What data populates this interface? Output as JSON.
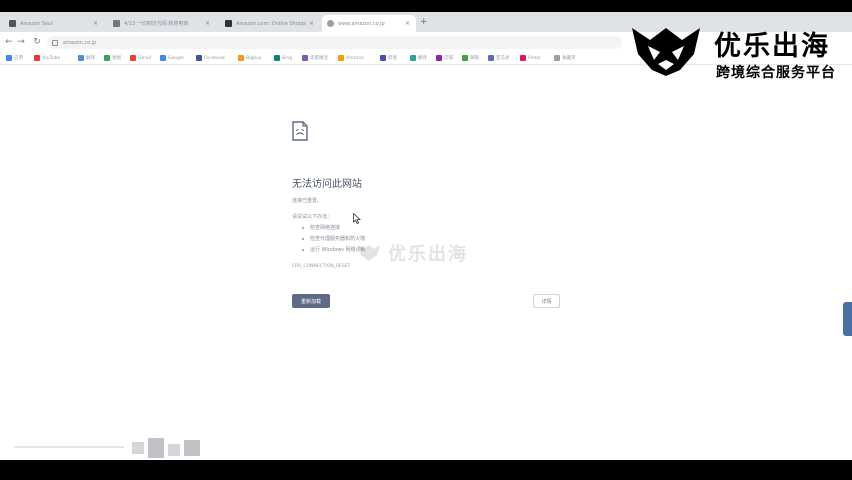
{
  "tabs": [
    {
      "label": "Amazon Seul",
      "active": false
    },
    {
      "label": "4/13 一切到达代码 跨境电商",
      "active": false
    },
    {
      "label": "Amazon.com: Online Shopping",
      "active": false
    },
    {
      "label": "www.amazon.co.jp",
      "active": true
    }
  ],
  "toolbar": {
    "back_icon": "←",
    "forward_icon": "→",
    "reload_icon": "↻",
    "home_icon": "⌂",
    "new_tab_icon": "+",
    "url": "amazon.co.jp"
  },
  "bookmarks": [
    {
      "label": "应用",
      "color": "#4285f4"
    },
    {
      "label": "YouTube",
      "color": "#e53935"
    },
    {
      "label": "翻译",
      "color": "#4a90e2"
    },
    {
      "label": "地图",
      "color": "#34a853"
    },
    {
      "label": "Gmail",
      "color": "#ea4335"
    },
    {
      "label": "Google",
      "color": "#4285f4"
    },
    {
      "label": "Facebook",
      "color": "#3b5998"
    },
    {
      "label": "Bigbuy",
      "color": "#f39c12"
    },
    {
      "label": "Bing",
      "color": "#00897b"
    },
    {
      "label": "卖家精灵",
      "color": "#7e57c2"
    },
    {
      "label": "Amazon",
      "color": "#ff9900"
    },
    {
      "label": "跨境",
      "color": "#3f51b5"
    },
    {
      "label": "翻译",
      "color": "#26a69a"
    },
    {
      "label": "店铺",
      "color": "#8e24aa"
    },
    {
      "label": "邮箱",
      "color": "#43a047"
    },
    {
      "label": "亚马逊",
      "color": "#5c6bc0"
    },
    {
      "label": "Pinter",
      "color": "#d81b60"
    },
    {
      "label": "收藏夹",
      "color": "#9e9e9e"
    }
  ],
  "error_page": {
    "title": "无法访问此网站",
    "subtitle": "连接已重置。",
    "try_label": "请试试以下办法：",
    "suggestions": [
      "检查网络连接",
      "检查代理服务器和防火墙",
      "运行 Windows 网络诊断"
    ],
    "error_code": "ERR_CONNECTION_RESET",
    "reload_button": "重新加载",
    "details_button": "详情"
  },
  "watermark": {
    "center_text": "优乐出海"
  },
  "brand": {
    "name": "优乐出海",
    "tagline": "跨境综合服务平台"
  }
}
